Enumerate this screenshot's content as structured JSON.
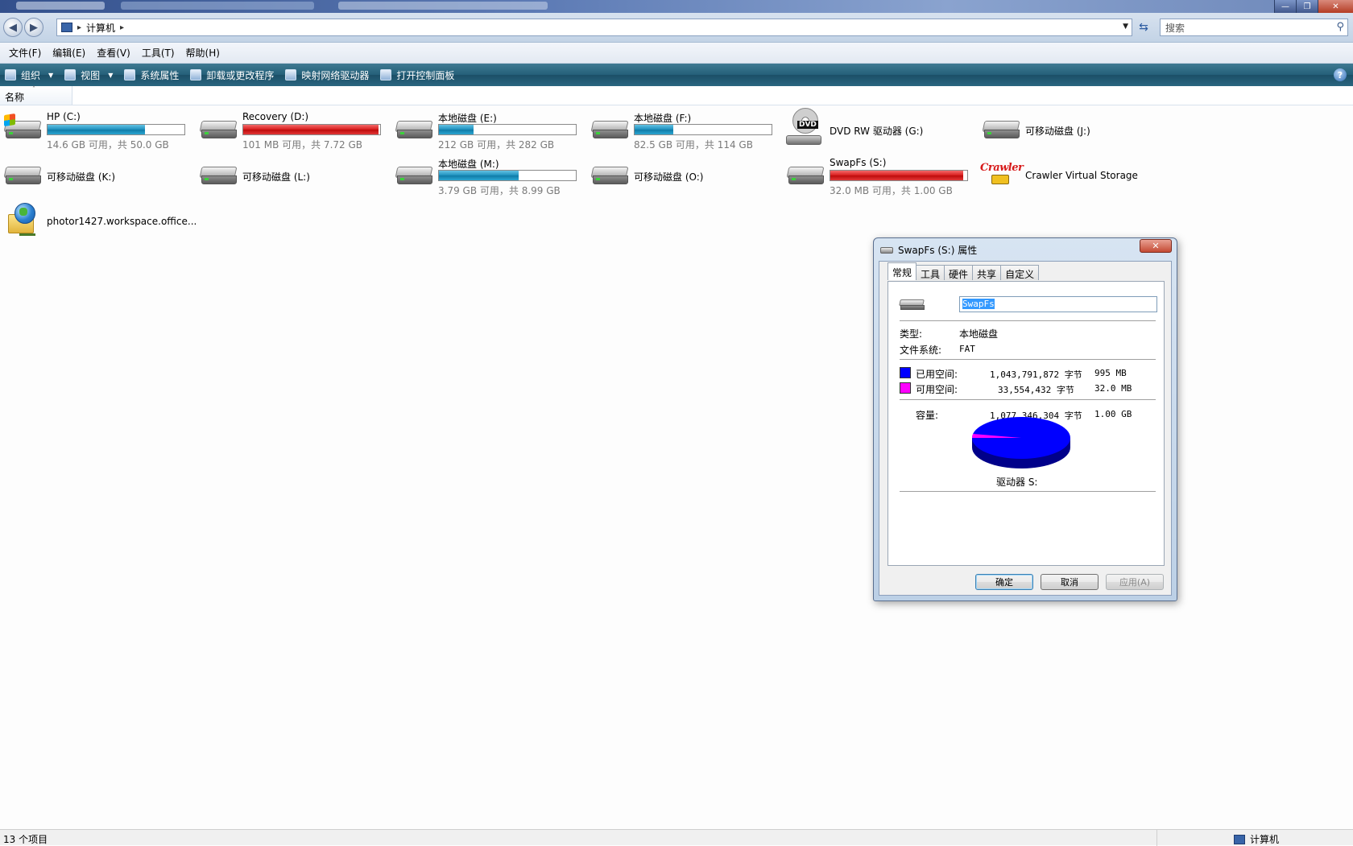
{
  "window": {
    "controls": [
      "minimize",
      "maximize",
      "close"
    ]
  },
  "address": {
    "crumb": "计算机",
    "search_placeholder": "搜索"
  },
  "menu": [
    "文件(F)",
    "编辑(E)",
    "查看(V)",
    "工具(T)",
    "帮助(H)"
  ],
  "commands": {
    "organize": "组织",
    "views": "视图",
    "system_properties": "系统属性",
    "uninstall": "卸载或更改程序",
    "map_drive": "映射网络驱动器",
    "control_panel": "打开控制面板"
  },
  "column_header": "名称",
  "drives": [
    {
      "name": "HP (C:)",
      "free": "14.6 GB 可用，共 50.0 GB",
      "used_fraction": 0.71,
      "bar": "blue",
      "icon": "windows-hdd-icon"
    },
    {
      "name": "Recovery (D:)",
      "free": "101 MB 可用，共 7.72 GB",
      "used_fraction": 0.99,
      "bar": "red",
      "icon": "hdd-icon"
    },
    {
      "name": "本地磁盘 (E:)",
      "free": "212 GB 可用，共 282 GB",
      "used_fraction": 0.25,
      "bar": "blue",
      "icon": "hdd-icon"
    },
    {
      "name": "本地磁盘 (F:)",
      "free": "82.5 GB 可用，共 114 GB",
      "used_fraction": 0.28,
      "bar": "blue",
      "icon": "hdd-icon"
    },
    {
      "name": "DVD RW 驱动器 (G:)",
      "icon": "dvd-drive-icon"
    },
    {
      "name": "可移动磁盘 (J:)",
      "icon": "removable-disk-icon"
    },
    {
      "name": "可移动磁盘 (K:)",
      "icon": "removable-disk-icon"
    },
    {
      "name": "可移动磁盘 (L:)",
      "icon": "removable-disk-icon"
    },
    {
      "name": "本地磁盘 (M:)",
      "free": "3.79 GB 可用，共 8.99 GB",
      "used_fraction": 0.58,
      "bar": "blue",
      "icon": "hdd-icon"
    },
    {
      "name": "可移动磁盘 (O:)",
      "icon": "removable-disk-icon"
    },
    {
      "name": "SwapFs (S:)",
      "free": "32.0 MB 可用，共 1.00 GB",
      "used_fraction": 0.97,
      "bar": "red",
      "icon": "hdd-icon"
    },
    {
      "name": "Crawler Virtual Storage",
      "logo_text": "Crawler",
      "icon": "crawler-storage-icon"
    },
    {
      "name": "photor1427.workspace.office...",
      "icon": "network-drive-icon"
    }
  ],
  "status": {
    "count": "13 个项目",
    "location": "计算机"
  },
  "dialog": {
    "title": "SwapFs (S:) 属性",
    "tabs": [
      "常规",
      "工具",
      "硬件",
      "共享",
      "自定义"
    ],
    "name_value": "SwapFs",
    "type_label": "类型:",
    "type_value": "本地磁盘",
    "fs_label": "文件系统:",
    "fs_value": "FAT",
    "used_label": "已用空间:",
    "used_bytes": "1,043,791,872 字节",
    "used_size": "995 MB",
    "free_label": "可用空间:",
    "free_bytes": "33,554,432 字节",
    "free_size": "32.0 MB",
    "capacity_label": "容量:",
    "capacity_bytes": "1,077,346,304 字节",
    "capacity_size": "1.00 GB",
    "drive_label": "驱动器 S:",
    "used_color": "#0000ff",
    "free_color": "#ff00ff",
    "used_fraction": 0.969,
    "ok": "确定",
    "cancel": "取消",
    "apply": "应用(A)"
  }
}
